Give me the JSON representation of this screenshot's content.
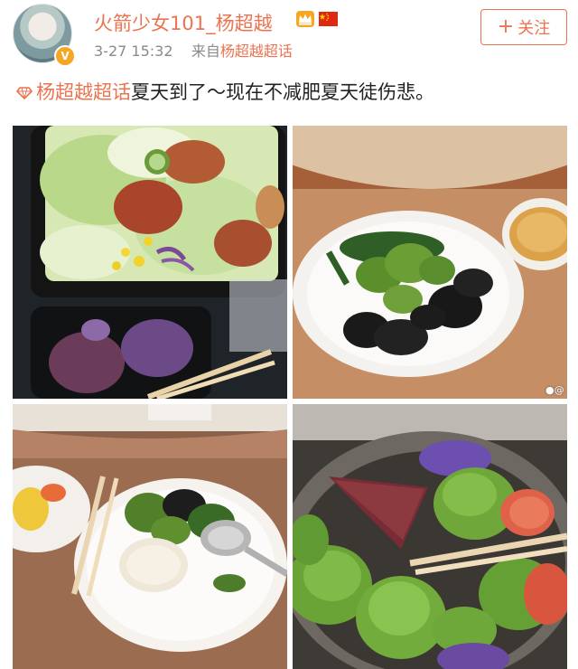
{
  "user": {
    "name": "火箭少女101_杨超越",
    "verified_badge": "V"
  },
  "meta": {
    "time": "3-27 15:32",
    "from_label": "来自",
    "source": "杨超越超话"
  },
  "follow_button": {
    "plus": "+",
    "label": "关注"
  },
  "post": {
    "topic": "杨超越超话",
    "text": "夏天到了～现在不减肥夏天徒伤悲。"
  },
  "photos": [
    {
      "id": "photo-1"
    },
    {
      "id": "photo-2"
    },
    {
      "id": "photo-3"
    },
    {
      "id": "photo-4"
    }
  ],
  "watermark": "@",
  "colors": {
    "accent": "#eb7350",
    "meta_gray": "#8a8a8a",
    "badge_gold": "#f5a623"
  },
  "icons": [
    "crown-icon",
    "china-flag-icon",
    "diamond-icon",
    "weibo-watermark-icon"
  ]
}
